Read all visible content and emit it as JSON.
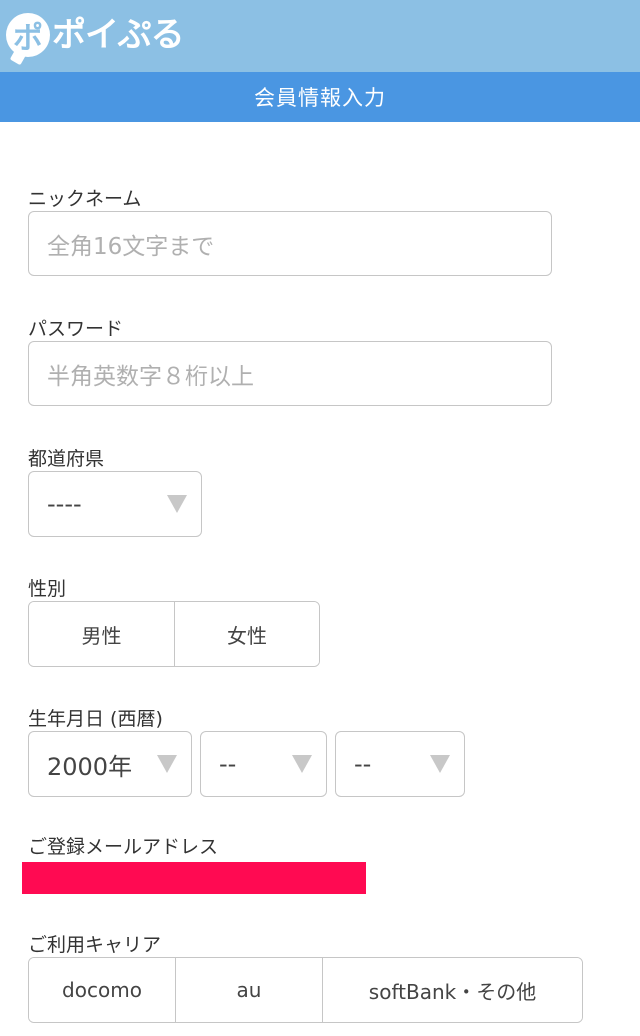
{
  "header": {
    "logo_text": "ポイぷる",
    "logo_mark": "ポ",
    "page_title": "会員情報入力"
  },
  "form": {
    "nickname": {
      "label": "ニックネーム",
      "placeholder": "全角16文字まで",
      "value": ""
    },
    "password": {
      "label": "パスワード",
      "placeholder": "半角英数字８桁以上",
      "value": ""
    },
    "prefecture": {
      "label": "都道府県",
      "selected": "----"
    },
    "gender": {
      "label": "性別",
      "options": [
        "男性",
        "女性"
      ]
    },
    "birthday": {
      "label": "生年月日 (西暦)",
      "year": "2000年",
      "month": "--",
      "day": "--"
    },
    "email": {
      "label": "ご登録メールアドレス"
    },
    "carrier": {
      "label": "ご利用キャリア",
      "options": [
        "docomo",
        "au",
        "softBank・その他"
      ]
    }
  },
  "colors": {
    "header_bg": "#8cc0e4",
    "title_bar_bg": "#4a96e2",
    "redaction": "#ff0a52"
  },
  "icons": {
    "dropdown": "caret-down-icon"
  }
}
